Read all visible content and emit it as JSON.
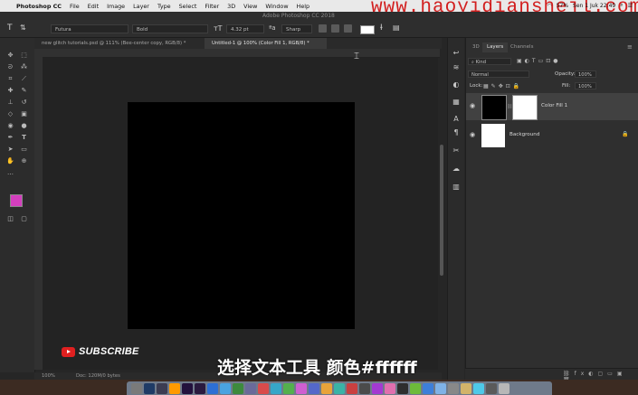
{
  "menubar": {
    "app_name": "Photoshop CC",
    "menus": [
      "File",
      "Edit",
      "Image",
      "Layer",
      "Type",
      "Select",
      "Filter",
      "3D",
      "View",
      "Window",
      "Help"
    ],
    "watermark": "www.haoyidianshejl.com",
    "battery": "57%",
    "datetime": "Sen 1 Juk 22:49"
  },
  "window_title": "Adobe Photoshop CC 2018",
  "options": {
    "font_family": "Futura",
    "font_style": "Bold",
    "font_size": "4.32 pt",
    "antialias": "Sharp",
    "text_color": "#ffffff"
  },
  "tabs": [
    {
      "label": "new glitch tutorials.psd @ 111% (Bee-center copy, RGB/8) *"
    },
    {
      "label": "Untitled-1 @ 100% (Color Fill 1, RGB/8) *"
    }
  ],
  "statusbar": {
    "zoom": "100%",
    "doc": "Doc: 120M/0 bytes"
  },
  "panel": {
    "tabs": [
      "3D",
      "Layers",
      "Channels"
    ],
    "kind": "Kind",
    "blend_mode": "Normal",
    "opacity_label": "Opacity:",
    "opacity_value": "100%",
    "lock_label": "Lock:",
    "fill_label": "Fill:",
    "fill_value": "100%",
    "layers": [
      {
        "name": "Color Fill 1"
      },
      {
        "name": "Background"
      }
    ]
  },
  "overlay": {
    "subscribe": "SUBSCRIBE",
    "caption": "选择文本工具 颜色#ffffff"
  }
}
